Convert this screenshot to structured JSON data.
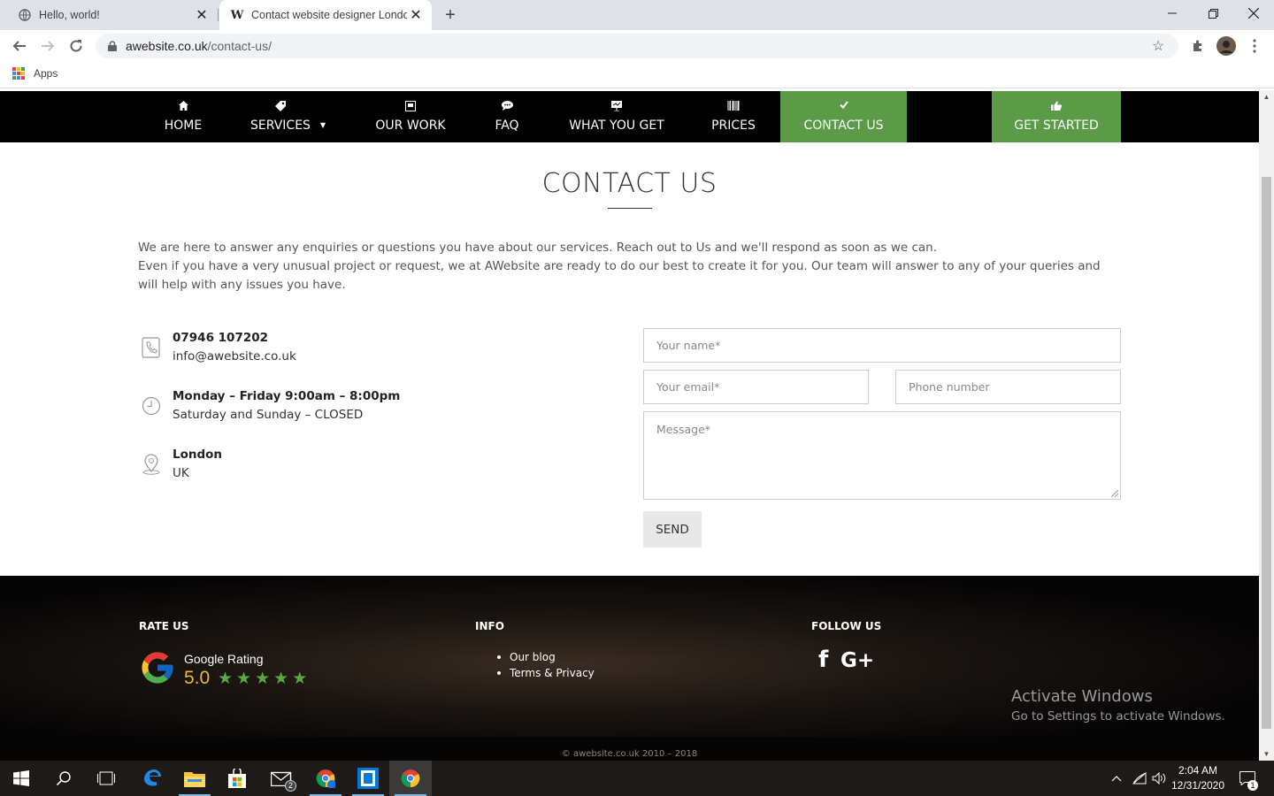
{
  "browser": {
    "tabs": [
      {
        "title": "Hello, world!",
        "favicon": "globe-icon"
      },
      {
        "title": "Contact website designer London",
        "favicon": "w-logo-icon"
      }
    ],
    "favicon_letter": "W",
    "url_host": "awebsite.co.uk",
    "url_path": "/contact-us/",
    "bookmark_apps": "Apps"
  },
  "nav": {
    "items": [
      {
        "label": "HOME",
        "icon": "home-icon"
      },
      {
        "label": "SERVICES",
        "icon": "tag-icon"
      },
      {
        "label": "OUR WORK",
        "icon": "briefcase-icon"
      },
      {
        "label": "FAQ",
        "icon": "chat-icon"
      },
      {
        "label": "WHAT YOU GET",
        "icon": "presentation-icon"
      },
      {
        "label": "PRICES",
        "icon": "barcode-icon"
      },
      {
        "label": "CONTACT US",
        "icon": "check-icon"
      },
      {
        "label": "GET STARTED",
        "icon": "thumbs-up-icon"
      }
    ],
    "active_color": "#5b9a47"
  },
  "page": {
    "title": "CONTACT US",
    "intro_line1": "We are here to answer any enquiries or questions you have about our services. Reach out to Us and we'll respond as soon as we can.",
    "intro_line2": "Even if you have a very unusual project or request, we at AWebsite are ready to do our best to create it for you. Our team will answer to any of your queries and will help with any issues you have."
  },
  "contact_info": {
    "phone": "07946 107202",
    "email": "info@awebsite.co.uk",
    "hours_weekdays": "Monday – Friday 9:00am – 8:00pm",
    "hours_weekend": "Saturday and Sunday – CLOSED",
    "city": "London",
    "country": "UK"
  },
  "form": {
    "name_placeholder": "Your name*",
    "email_placeholder": "Your email*",
    "phone_placeholder": "Phone number",
    "message_placeholder": "Message*",
    "send_label": "SEND"
  },
  "footer": {
    "rate_heading": "RATE US",
    "google_label": "Google Rating",
    "google_score": "5.0",
    "stars": 5,
    "info_heading": "INFO",
    "info_links": [
      "Our blog",
      "Terms & Privacy"
    ],
    "follow_heading": "FOLLOW US",
    "social": [
      "facebook-icon",
      "google-plus-icon"
    ],
    "facebook_glyph": "f",
    "google_plus_glyph": "G+",
    "copyright": "© awebsite.co.uk 2010 – 2018"
  },
  "watermark": {
    "line1": "Activate Windows",
    "line2": "Go to Settings to activate Windows."
  },
  "taskbar": {
    "time": "2:04 AM",
    "date": "12/31/2020",
    "mail_badge": "2",
    "notification_count": "1"
  }
}
